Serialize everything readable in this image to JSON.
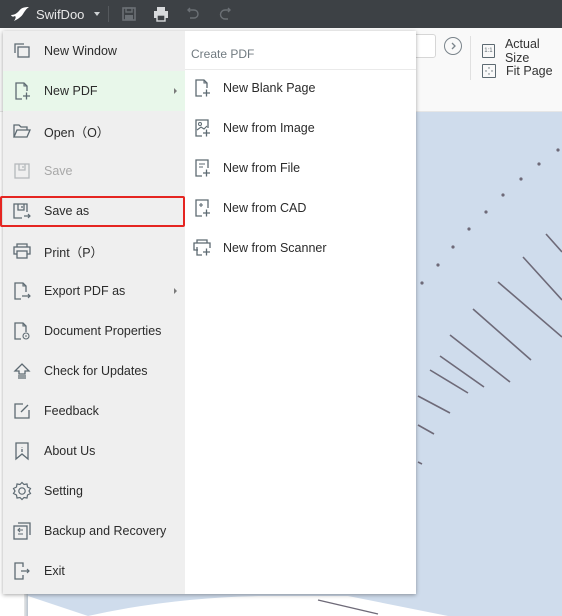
{
  "titlebar": {
    "app_name": "SwifDoo",
    "icons": [
      "swifdoo-logo-icon",
      "dropdown-caret-icon",
      "save-icon",
      "print-icon",
      "undo-icon",
      "redo-icon"
    ],
    "colors": {
      "background": "#3d4145",
      "text": "#e8e8e8"
    }
  },
  "toolbar": {
    "go_icon": "circle-chevron-right-icon",
    "actual_size_label": "Actual Size",
    "actual_size_icon_text": "1:1",
    "fit_page_label": "Fit Page"
  },
  "file_menu": {
    "items": [
      {
        "label": "New Window",
        "icon": "new-window-icon",
        "state": "normal"
      },
      {
        "label": "New PDF",
        "icon": "new-pdf-icon",
        "state": "active",
        "has_submenu": true
      },
      {
        "label": "Open（O）",
        "icon": "open-folder-icon",
        "state": "normal"
      },
      {
        "label": "Save",
        "icon": "save-icon",
        "state": "disabled"
      },
      {
        "label": "Save as",
        "icon": "save-as-icon",
        "state": "highlighted"
      },
      {
        "label": "Print（P）",
        "icon": "print-icon",
        "state": "normal"
      },
      {
        "label": "Export PDF as",
        "icon": "export-icon",
        "state": "normal",
        "has_submenu": true
      },
      {
        "label": "Document Properties",
        "icon": "document-properties-icon",
        "state": "normal"
      },
      {
        "label": "Check for Updates",
        "icon": "update-icon",
        "state": "normal"
      },
      {
        "label": "Feedback",
        "icon": "feedback-icon",
        "state": "normal"
      },
      {
        "label": "About Us",
        "icon": "about-icon",
        "state": "normal"
      },
      {
        "label": "Setting",
        "icon": "gear-icon",
        "state": "normal"
      },
      {
        "label": "Backup and Recovery",
        "icon": "backup-icon",
        "state": "normal"
      },
      {
        "label": "Exit",
        "icon": "exit-icon",
        "state": "normal"
      }
    ],
    "colors": {
      "active_bg": "#e8f7ea",
      "highlight_border": "#e52521",
      "panel_bg": "#efefef"
    }
  },
  "submenu": {
    "title": "Create PDF",
    "items": [
      {
        "label": "New Blank Page",
        "icon": "new-blank-page-icon"
      },
      {
        "label": "New from Image",
        "icon": "new-from-image-icon"
      },
      {
        "label": "New from File",
        "icon": "new-from-file-icon"
      },
      {
        "label": "New from CAD",
        "icon": "new-from-cad-icon"
      },
      {
        "label": "New from Scanner",
        "icon": "new-from-scanner-icon"
      }
    ]
  },
  "canvas": {
    "background": "#cfdcec",
    "line_color": "#6e6a78"
  }
}
